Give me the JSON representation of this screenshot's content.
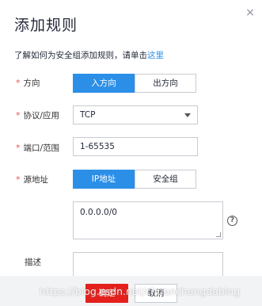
{
  "dialog": {
    "title": "添加规则",
    "close_icon": "×"
  },
  "intro": {
    "text": "了解如何为安全组添加规则，请单击",
    "link": "这里"
  },
  "required_mark": "*",
  "direction": {
    "label": "方向",
    "options": [
      "入方向",
      "出方向"
    ],
    "selected": "入方向"
  },
  "protocol": {
    "label": "协议/应用",
    "value": "TCP"
  },
  "port": {
    "label": "端口/范围",
    "value": "1-65535"
  },
  "source": {
    "label": "源地址",
    "options": [
      "IP地址",
      "安全组"
    ],
    "selected": "IP地址",
    "value": "0.0.0.0/0",
    "help_icon": "?"
  },
  "description": {
    "label": "描述",
    "value": ""
  },
  "footer": {
    "ok_label": "确定",
    "cancel_label": "取消"
  },
  "watermark": "https://blog.csdn.net/chuanchengdabing",
  "colors": {
    "accent": "#2b8fe8",
    "required": "#f05050",
    "primary_button": "#e4201d"
  }
}
